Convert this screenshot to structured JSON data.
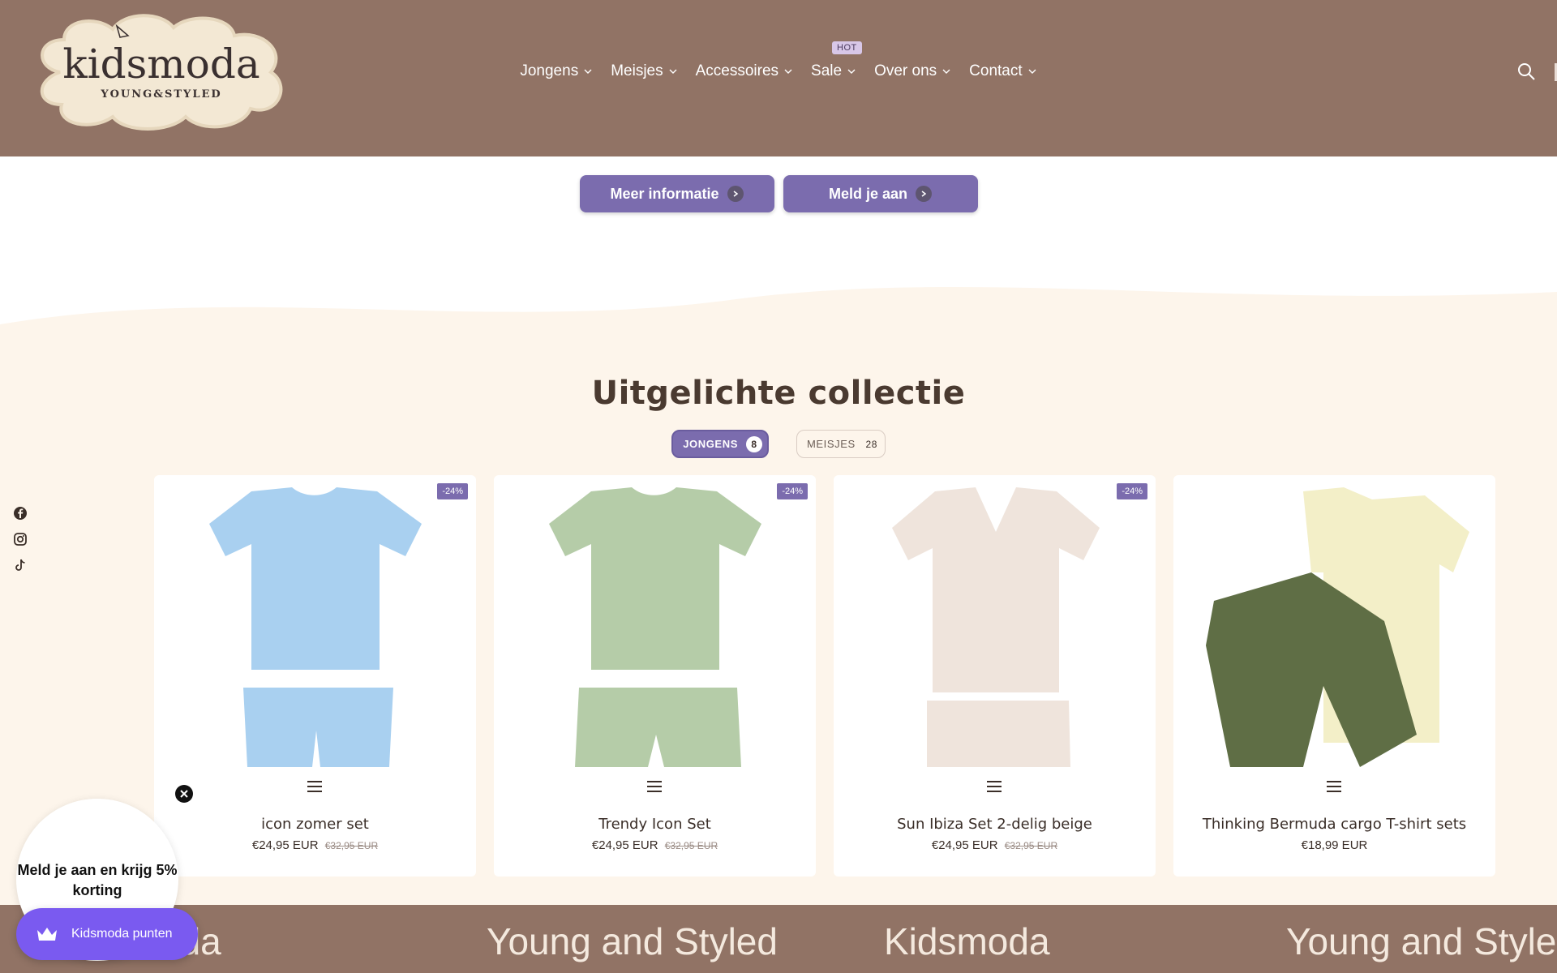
{
  "header": {
    "logo_text": "kidsmoda",
    "logo_tagline": "YOUNG&STYLED",
    "nav": [
      {
        "label": "Jongens"
      },
      {
        "label": "Meisjes"
      },
      {
        "label": "Accessoires"
      },
      {
        "label": "Sale",
        "badge": "HOT"
      },
      {
        "label": "Over ons"
      },
      {
        "label": "Contact"
      }
    ]
  },
  "cta": {
    "more_info": "Meer informatie",
    "signup": "Meld je aan"
  },
  "featured": {
    "title": "Uitgelichte collectie",
    "tabs": [
      {
        "label": "JONGENS",
        "count": "8",
        "active": true
      },
      {
        "label": "MEISJES",
        "count": "28",
        "active": false
      }
    ],
    "products": [
      {
        "title": "icon zomer set",
        "price": "€24,95 EUR",
        "old_price": "€32,95 EUR",
        "badge": "-24%",
        "color": "#a9d0f0"
      },
      {
        "title": "Trendy Icon Set",
        "price": "€24,95 EUR",
        "old_price": "€32,95 EUR",
        "badge": "-24%",
        "color": "#b5cca8"
      },
      {
        "title": "Sun Ibiza Set 2-delig beige",
        "price": "€24,95 EUR",
        "old_price": "€32,95 EUR",
        "badge": "-24%",
        "color": "#efe4dc"
      },
      {
        "title": "Thinking Bermuda cargo T-shirt sets",
        "price": "€18,99 EUR",
        "old_price": "",
        "badge": "",
        "color": "#f3efc8"
      }
    ]
  },
  "marquee": [
    "oda",
    "Young and Styled",
    "Kidsmoda",
    "Young and Styled"
  ],
  "popup": {
    "text": "Meld je aan en krijg 5% korting"
  },
  "rewards": {
    "label": "Kidsmoda punten"
  },
  "colors": {
    "header_bg": "#917365",
    "accent": "#7b6cae",
    "cream": "#fdf5eb",
    "rewards": "#7a5af0"
  }
}
